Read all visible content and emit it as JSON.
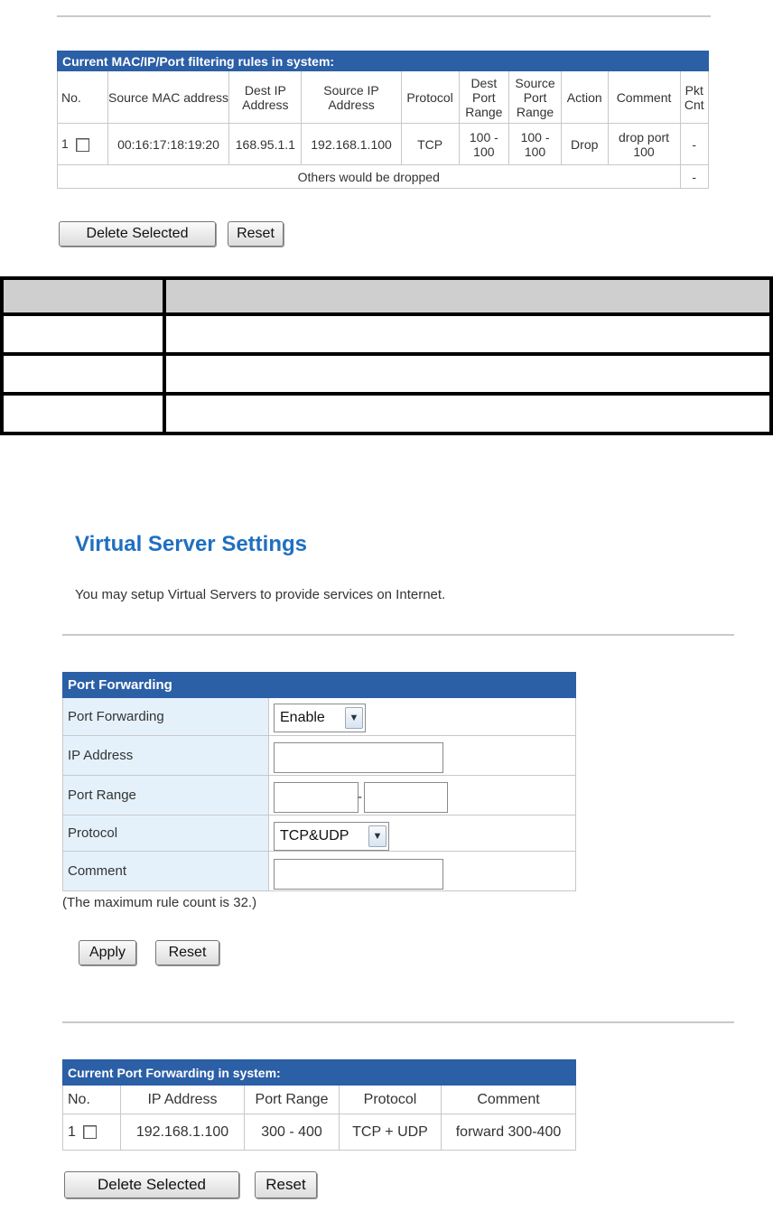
{
  "filter_section": {
    "header": "Current MAC/IP/Port filtering rules in system:",
    "columns": [
      "No.",
      "Source MAC address",
      "Dest IP Address",
      "Source IP Address",
      "Protocol",
      "Dest Port Range",
      "Source Port Range",
      "Action",
      "Comment",
      "Pkt Cnt"
    ],
    "rows": [
      {
        "no": "1",
        "src_mac": "00:16:17:18:19:20",
        "dest_ip": "168.95.1.1",
        "src_ip": "192.168.1.100",
        "protocol": "TCP",
        "dest_port": "100 - 100",
        "src_port": "100 - 100",
        "action": "Drop",
        "comment": "drop port 100",
        "pkt": "-"
      }
    ],
    "others_text": "Others would be dropped",
    "others_pkt": "-",
    "delete_label": "Delete Selected",
    "reset_label": "Reset"
  },
  "virtual_server": {
    "title": "Virtual Server Settings",
    "subtitle": "You may setup Virtual Servers to provide services on Internet.",
    "form_header": "Port Forwarding",
    "fields": {
      "port_forwarding_label": "Port Forwarding",
      "port_forwarding_value": "Enable",
      "ip_label": "IP Address",
      "ip_value": "",
      "port_range_label": "Port Range",
      "port_range_sep": "-",
      "protocol_label": "Protocol",
      "protocol_value": "TCP&UDP",
      "comment_label": "Comment",
      "comment_value": ""
    },
    "max_note": "(The maximum rule count is 32.)",
    "apply_label": "Apply",
    "reset_label": "Reset"
  },
  "current_forwarding": {
    "header": "Current Port Forwarding in system:",
    "columns": [
      "No.",
      "IP Address",
      "Port Range",
      "Protocol",
      "Comment"
    ],
    "rows": [
      {
        "no": "1",
        "ip": "192.168.1.100",
        "range": "300 - 400",
        "protocol": "TCP + UDP",
        "comment": "forward 300-400"
      }
    ],
    "delete_label": "Delete Selected",
    "reset_label": "Reset"
  }
}
